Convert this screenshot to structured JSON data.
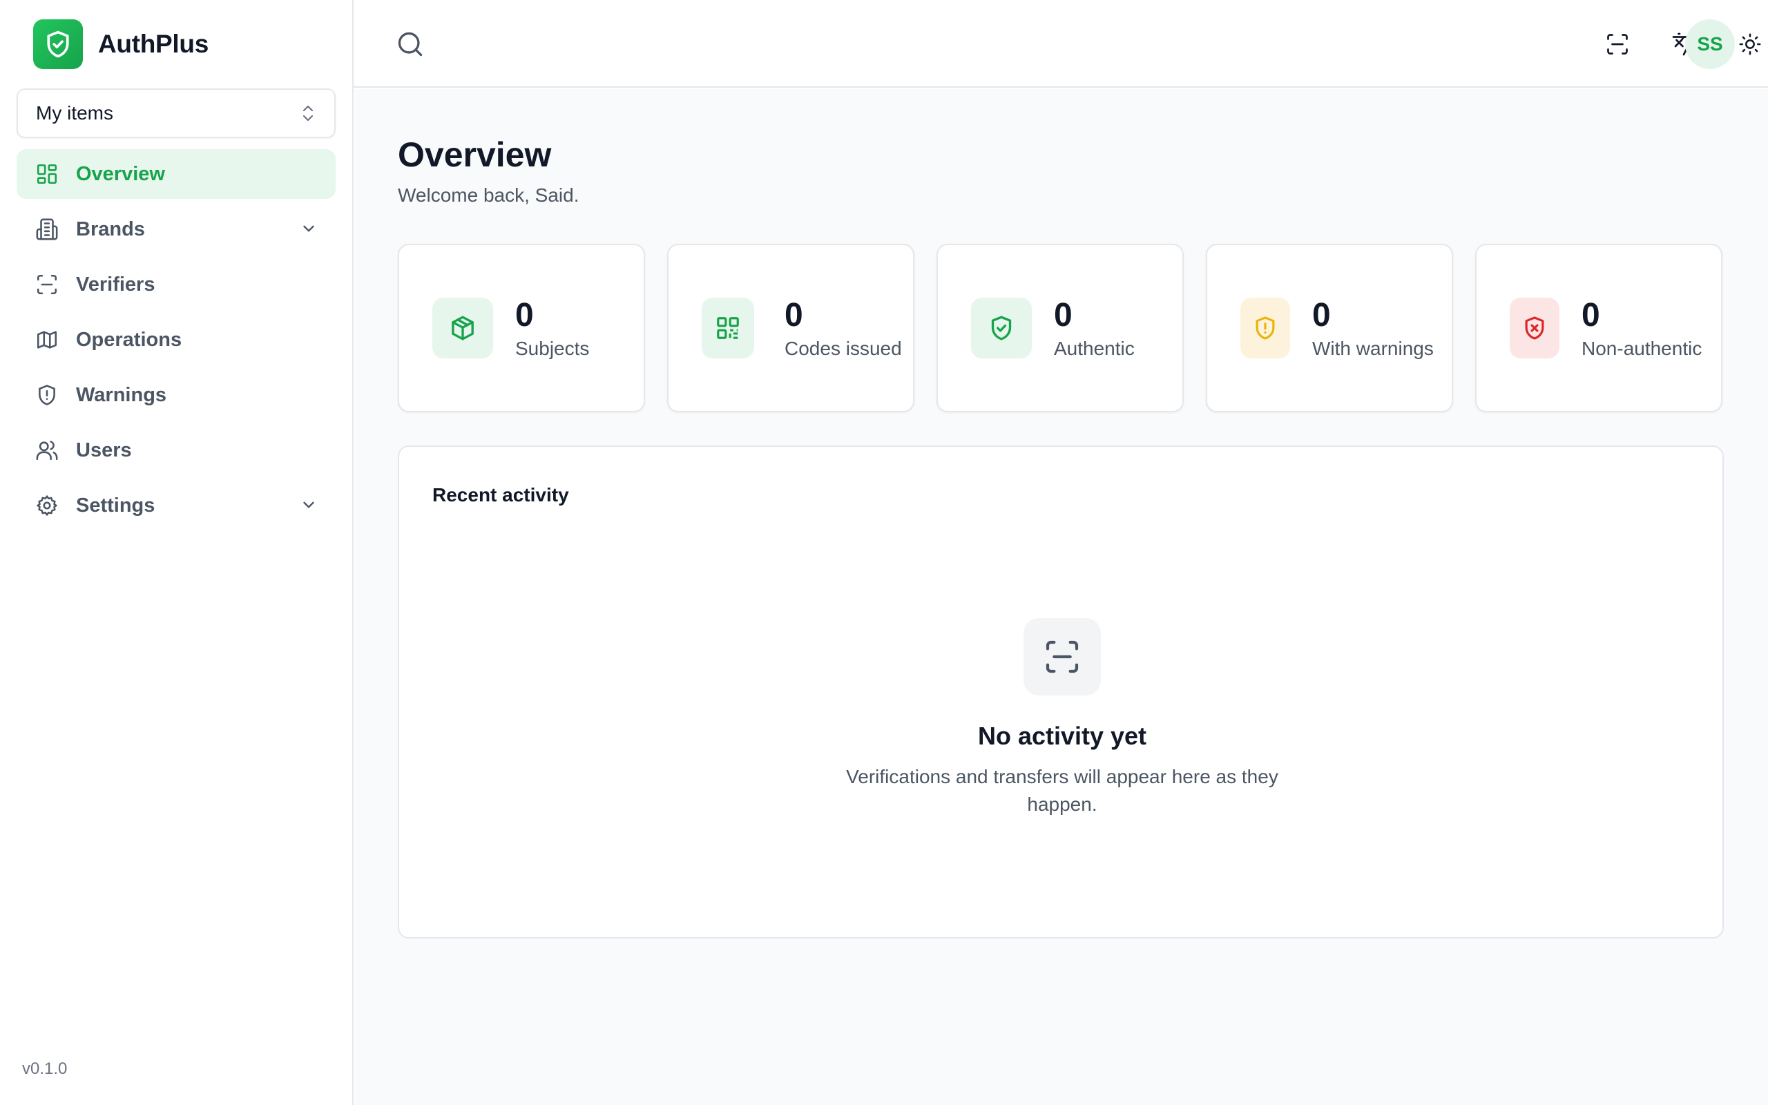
{
  "app": {
    "name": "AuthPlus",
    "version": "v0.1.0"
  },
  "sidebar": {
    "workspace": "My items",
    "items": [
      {
        "label": "Overview",
        "icon": "layout-grid-icon",
        "active": true
      },
      {
        "label": "Brands",
        "icon": "building-icon",
        "expandable": true
      },
      {
        "label": "Verifiers",
        "icon": "scan-icon"
      },
      {
        "label": "Operations",
        "icon": "map-icon"
      },
      {
        "label": "Warnings",
        "icon": "shield-alert-icon"
      },
      {
        "label": "Users",
        "icon": "users-icon"
      },
      {
        "label": "Settings",
        "icon": "gear-icon",
        "expandable": true
      }
    ]
  },
  "topbar": {
    "avatar_initials": "SS"
  },
  "page": {
    "title": "Overview",
    "subtitle": "Welcome back, Said."
  },
  "stats": [
    {
      "value": "0",
      "label": "Subjects",
      "icon": "package-icon",
      "color": "#16a34a",
      "bg": "#e6f6ec"
    },
    {
      "value": "0",
      "label": "Codes issued",
      "icon": "qr-code-icon",
      "color": "#16a34a",
      "bg": "#e6f6ec"
    },
    {
      "value": "0",
      "label": "Authentic",
      "icon": "shield-check-icon",
      "color": "#16a34a",
      "bg": "#e6f6ec"
    },
    {
      "value": "0",
      "label": "With warnings",
      "icon": "shield-alert-icon",
      "color": "#eab308",
      "bg": "#fdf3dc"
    },
    {
      "value": "0",
      "label": "Non-authentic",
      "icon": "shield-x-icon",
      "color": "#dc2626",
      "bg": "#fce5e5"
    }
  ],
  "activity": {
    "title": "Recent activity",
    "empty_title": "No activity yet",
    "empty_description": "Verifications and transfers will appear here as they happen."
  },
  "colors": {
    "accent": "#16a34a",
    "accent_bg": "#e8f7ee"
  }
}
